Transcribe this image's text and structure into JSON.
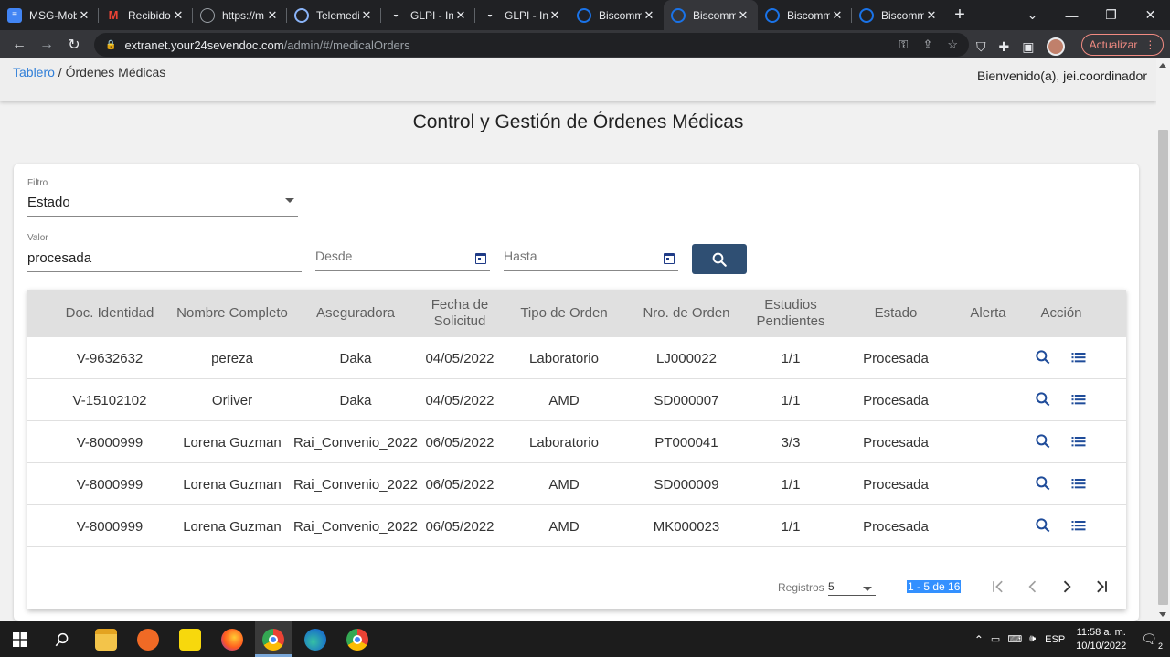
{
  "browser": {
    "tabs": [
      {
        "title": "MSG-Mobile",
        "icon": "docs-icon",
        "color": "#4285f4"
      },
      {
        "title": "Recibidos",
        "icon": "gmail-icon",
        "color": "#ea4335"
      },
      {
        "title": "https://m",
        "icon": "globe-icon",
        "color": "#9aa0a6"
      },
      {
        "title": "Telemedicina",
        "icon": "biscomm-icon",
        "color": "#1a73e8"
      },
      {
        "title": "GLPI - Inicio",
        "icon": "glpi-icon",
        "color": "#e8eaed"
      },
      {
        "title": "GLPI - Inicio",
        "icon": "glpi-icon",
        "color": "#e8eaed"
      },
      {
        "title": "Biscomm",
        "icon": "biscomm-icon",
        "color": "#1a73e8"
      },
      {
        "title": "Biscomm",
        "icon": "biscomm-icon",
        "color": "#1a73e8"
      },
      {
        "title": "Biscomm",
        "icon": "biscomm-icon",
        "color": "#1a73e8"
      },
      {
        "title": "Biscomm",
        "icon": "biscomm-icon",
        "color": "#1a73e8"
      }
    ],
    "url_host": "extranet.your24sevendoc.com",
    "url_path": "/admin/#/medicalOrders",
    "update_label": "Actualizar"
  },
  "header": {
    "breadcrumb_link": "Tablero",
    "breadcrumb_sep": " / ",
    "breadcrumb_current": "Órdenes Médicas",
    "welcome": "Bienvenido(a), jei.coordinador"
  },
  "page_title": "Control y Gestión de Órdenes Médicas",
  "filters": {
    "filter_label": "Filtro",
    "filter_value": "Estado",
    "value_label": "Valor",
    "value_value": "procesada",
    "desde_placeholder": "Desde",
    "hasta_placeholder": "Hasta"
  },
  "table": {
    "headers": [
      "Doc. Identidad",
      "Nombre Completo",
      "Aseguradora",
      "Fecha de Solicitud",
      "Tipo de Orden",
      "Nro. de Orden",
      "Estudios Pendientes",
      "Estado",
      "Alerta",
      "Acción"
    ],
    "rows": [
      [
        "V-9632632",
        "pereza",
        "Daka",
        "04/05/2022",
        "Laboratorio",
        "LJ000022",
        "1/1",
        "Procesada"
      ],
      [
        "V-15102102",
        "Orliver",
        "Daka",
        "04/05/2022",
        "AMD",
        "SD000007",
        "1/1",
        "Procesada"
      ],
      [
        "V-8000999",
        "Lorena Guzman",
        "Rai_Convenio_2022",
        "06/05/2022",
        "Laboratorio",
        "PT000041",
        "3/3",
        "Procesada"
      ],
      [
        "V-8000999",
        "Lorena Guzman",
        "Rai_Convenio_2022",
        "06/05/2022",
        "AMD",
        "SD000009",
        "1/1",
        "Procesada"
      ],
      [
        "V-8000999",
        "Lorena Guzman",
        "Rai_Convenio_2022",
        "06/05/2022",
        "AMD",
        "MK000023",
        "1/1",
        "Procesada"
      ]
    ]
  },
  "paginator": {
    "label": "Registros",
    "page_size": "5",
    "range": "1 - 5 de 16"
  },
  "taskbar": {
    "lang": "ESP",
    "time": "11:58 a. m.",
    "date": "10/10/2022",
    "notifications": "2"
  },
  "colors": {
    "primary_button": "#2f4f73",
    "link": "#2f7ed8",
    "table_header": "#e0e0e0"
  }
}
